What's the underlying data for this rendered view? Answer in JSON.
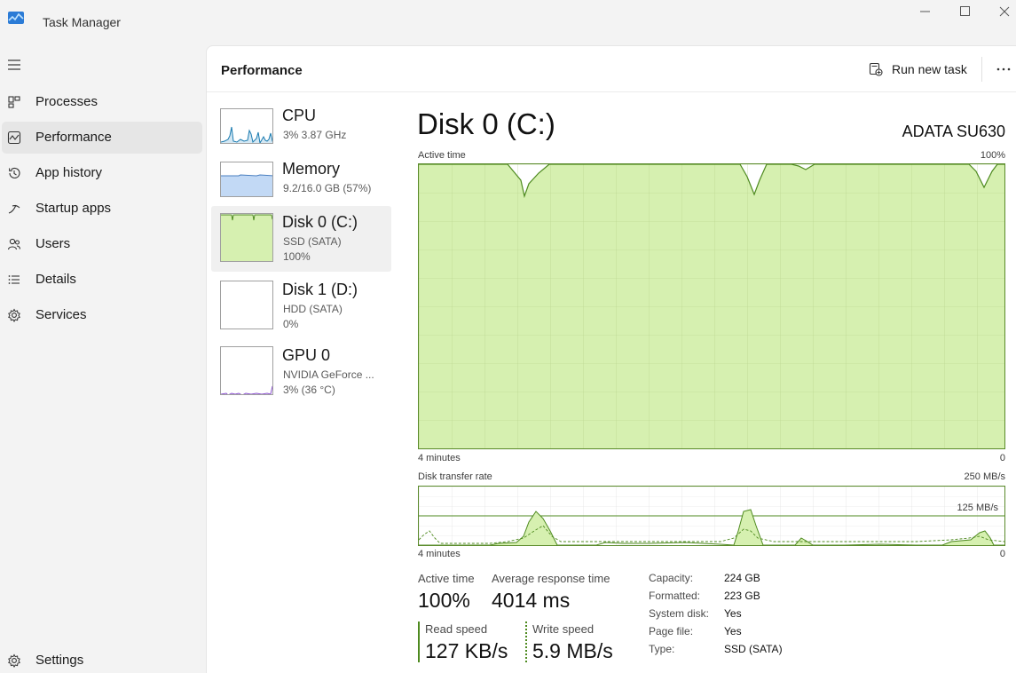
{
  "window": {
    "title": "Task Manager"
  },
  "sidebar": {
    "items": [
      {
        "label": "Processes",
        "icon": "processes-icon"
      },
      {
        "label": "Performance",
        "icon": "performance-icon",
        "active": true
      },
      {
        "label": "App history",
        "icon": "history-icon"
      },
      {
        "label": "Startup apps",
        "icon": "startup-icon"
      },
      {
        "label": "Users",
        "icon": "users-icon"
      },
      {
        "label": "Details",
        "icon": "details-icon"
      },
      {
        "label": "Services",
        "icon": "services-icon"
      }
    ],
    "settings_label": "Settings"
  },
  "header": {
    "title": "Performance",
    "run_task_label": "Run new task"
  },
  "devices": [
    {
      "name": "CPU",
      "line1": "3%  3.87 GHz",
      "line2": ""
    },
    {
      "name": "Memory",
      "line1": "9.2/16.0 GB (57%)",
      "line2": ""
    },
    {
      "name": "Disk 0 (C:)",
      "line1": "SSD (SATA)",
      "line2": "100%",
      "active": true
    },
    {
      "name": "Disk 1 (D:)",
      "line1": "HDD (SATA)",
      "line2": "0%"
    },
    {
      "name": "GPU 0",
      "line1": "NVIDIA GeForce ...",
      "line2": "3% (36 °C)"
    }
  ],
  "detail": {
    "title": "Disk 0 (C:)",
    "model": "ADATA SU630",
    "active_chart": {
      "label": "Active time",
      "max_label": "100%",
      "time_left": "4 minutes",
      "time_right": "0"
    },
    "transfer_chart": {
      "label": "Disk transfer rate",
      "max_label": "250 MB/s",
      "mid_label": "125 MB/s",
      "time_left": "4 minutes",
      "time_right": "0"
    },
    "stats": {
      "active_time_label": "Active time",
      "active_time_value": "100%",
      "avg_response_label": "Average response time",
      "avg_response_value": "4014 ms",
      "read_label": "Read speed",
      "read_value": "127 KB/s",
      "write_label": "Write speed",
      "write_value": "5.9 MB/s"
    },
    "properties": [
      {
        "label": "Capacity:",
        "value": "224 GB"
      },
      {
        "label": "Formatted:",
        "value": "223 GB"
      },
      {
        "label": "System disk:",
        "value": "Yes"
      },
      {
        "label": "Page file:",
        "value": "Yes"
      },
      {
        "label": "Type:",
        "value": "SSD (SATA)"
      }
    ]
  },
  "colors": {
    "disk_fill": "#d6f0b0",
    "disk_line": "#4e8a1f",
    "memory_fill": "#c2d9f5",
    "cpu_line": "#1a7bb0",
    "gpu_line": "#8a4fd0"
  }
}
